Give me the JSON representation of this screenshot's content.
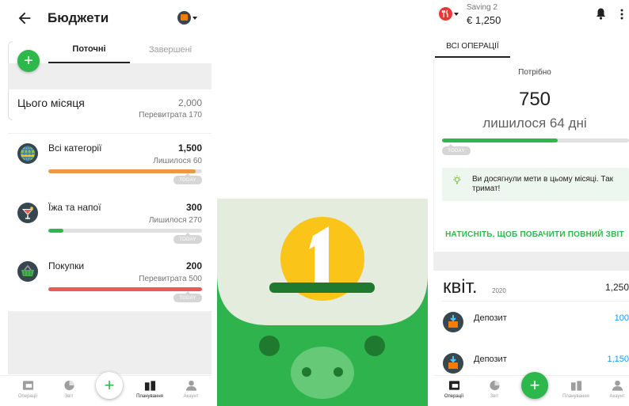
{
  "left": {
    "title": "Бюджети",
    "tabs": [
      {
        "label": "Поточні",
        "active": true
      },
      {
        "label": "Завершені",
        "active": false
      }
    ],
    "month": {
      "label": "Цього місяця",
      "amount": "2,000",
      "sub": "Перевитрата 170"
    },
    "budgets": [
      {
        "name": "Всі категорії",
        "amount": "1,500",
        "sub": "Лишилося 60",
        "progress": 0.96,
        "color": "#e8994a",
        "icon": "globe-icon"
      },
      {
        "name": "Їжа та напої",
        "amount": "300",
        "sub": "Лишилося 270",
        "progress": 0.1,
        "color": "#2db84c",
        "icon": "cocktail-icon"
      },
      {
        "name": "Покупки",
        "amount": "200",
        "sub": "Перевитрата 500",
        "progress": 1.0,
        "color": "#e85a5a",
        "icon": "basket-icon"
      }
    ],
    "today": "TODAY"
  },
  "nav": [
    {
      "label": "Операції",
      "icon": "wallet-icon"
    },
    {
      "label": "Звіт",
      "icon": "pie-chart-icon"
    },
    {
      "label": "",
      "icon": "add-icon"
    },
    {
      "label": "Планування",
      "icon": "planning-icon"
    },
    {
      "label": "Акаунт",
      "icon": "account-icon"
    }
  ],
  "right": {
    "wallet_name": "Saving 2",
    "wallet_balance": "€ 1,250",
    "tab": "ВСІ ОПЕРАЦІЇ",
    "need_label": "Потрібно",
    "need_amount": "750",
    "days_left": "лишилося 64 дні",
    "progress": 0.62,
    "today": "TODAY",
    "tip": "Ви досягнули мети в цьому місяці. Так тримат!",
    "full_report": "НАТИСНІТЬ, ЩОБ ПОБАЧИТИ ПОВНИЙ ЗВІТ",
    "month": "квіт.",
    "year": "2020",
    "month_total": "1,250",
    "transactions": [
      {
        "name": "Депозит",
        "amount": "100"
      },
      {
        "name": "Депозит",
        "amount": "1,150"
      }
    ]
  },
  "colors": {
    "brand_green": "#2db84c",
    "piggy_green": "#2fb44d",
    "coin_yellow": "#fbc419",
    "income_blue": "#2196f3"
  }
}
